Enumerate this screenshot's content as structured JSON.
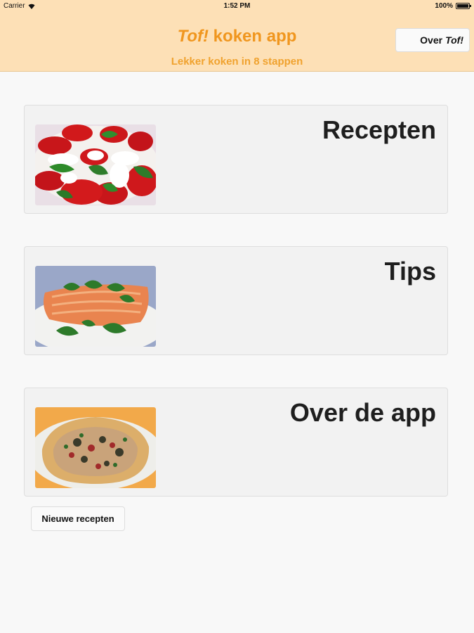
{
  "status_bar": {
    "carrier": "Carrier",
    "time": "1:52 PM",
    "battery": "100%",
    "icons": [
      "wifi-icon",
      "battery-icon"
    ]
  },
  "header": {
    "title_tof": "Tof!",
    "title_rest": " koken app",
    "subtitle": "Lekker koken in 8 stappen",
    "about_button": {
      "prefix": "Over",
      "tof": "Tof!"
    }
  },
  "menu": {
    "items": [
      {
        "label": "Recepten",
        "image": "caprese-salad-image"
      },
      {
        "label": "Tips",
        "image": "salmon-dish-image"
      },
      {
        "label": "Over de app",
        "image": "quiche-image"
      }
    ]
  },
  "new_recipes_button": "Nieuwe recepten",
  "colors": {
    "header_bg": "#fde0b6",
    "accent": "#f0961e",
    "background": "#f8f8f8"
  }
}
